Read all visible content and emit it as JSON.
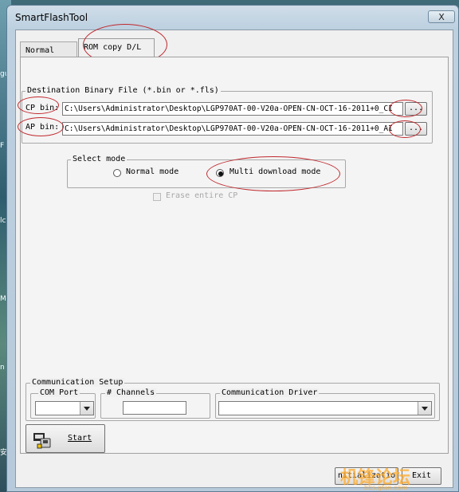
{
  "desktop": {
    "edge_chars": [
      "gu",
      "F",
      "lc",
      "M",
      "n",
      "安"
    ]
  },
  "window": {
    "title": "SmartFlashTool",
    "close_label": "X"
  },
  "tabs": [
    {
      "label": "Normal D/L"
    },
    {
      "label": "ROM copy D/L"
    }
  ],
  "destination": {
    "group_label": "Destination Binary File (*.bin or *.fls)",
    "cp_label": "CP bin:",
    "cp_value": "C:\\Users\\Administrator\\Desktop\\LGP970AT-00-V20a-OPEN-CN-OCT-16-2011+0_CI",
    "ap_label": "AP bin:",
    "ap_value": "C:\\Users\\Administrator\\Desktop\\LGP970AT-00-V20a-OPEN-CN-OCT-16-2011+0_AI",
    "browse_label": "..."
  },
  "select_mode": {
    "group_label": "Select mode",
    "normal_label": "Normal mode",
    "multi_label": "Multi download mode",
    "selected": "multi",
    "erase_label": "Erase entire CP"
  },
  "comm": {
    "group_label": "Communication Setup",
    "com_port_label": "COM Port",
    "channels_label": "# Channels",
    "driver_label": "Communication Driver"
  },
  "buttons": {
    "start_label": "Start",
    "init_label": "nitializatio",
    "exit_label": "Exit"
  },
  "watermark": {
    "text": "机锋论坛",
    "sub": "bbs.gfan.com"
  },
  "colors": {
    "annotation_red": "#c0282d"
  }
}
